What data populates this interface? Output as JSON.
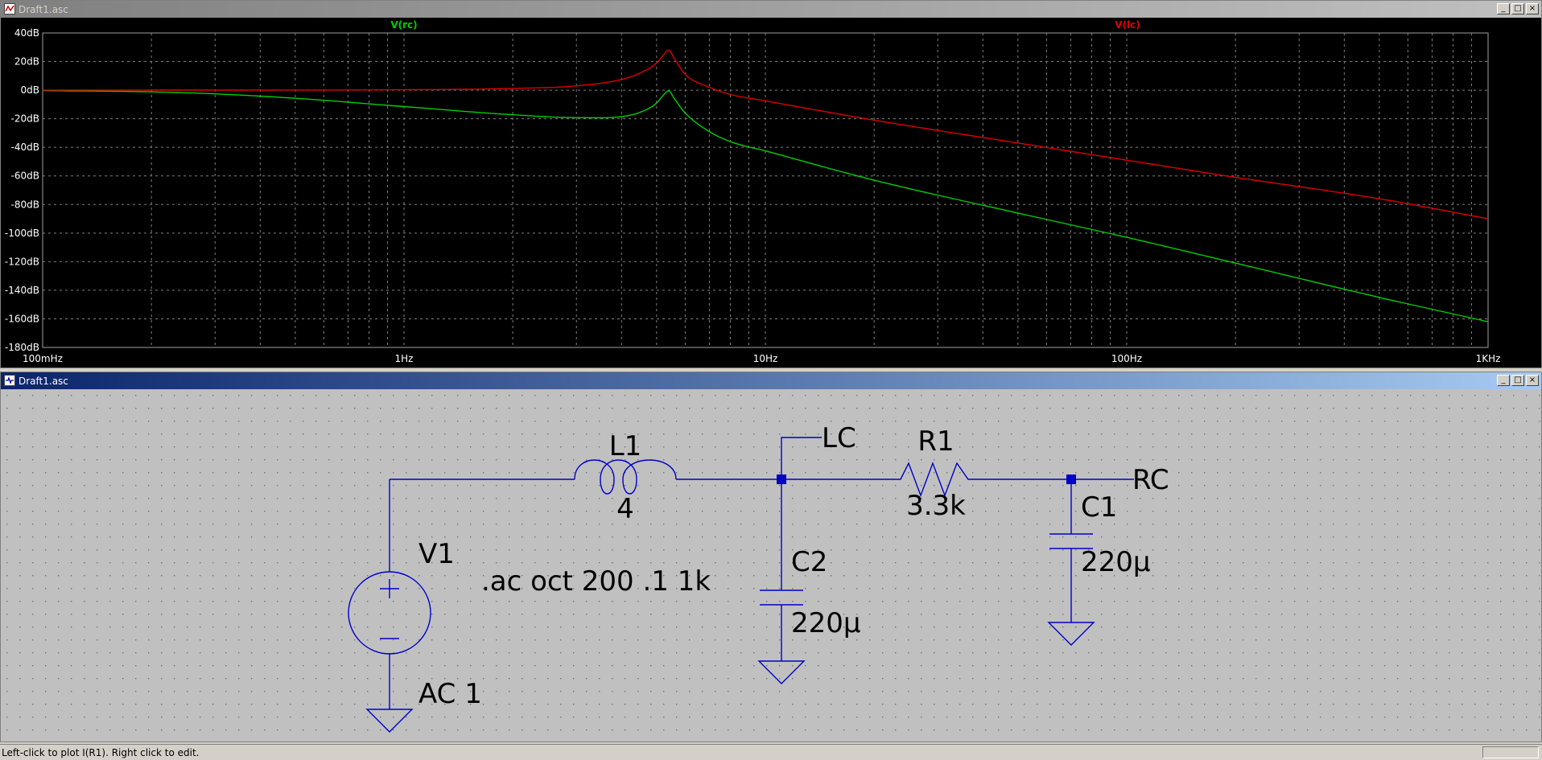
{
  "plot_window": {
    "title": "Draft1.asc",
    "trace_labels": [
      "V(rc)",
      "V(lc)"
    ],
    "colors": {
      "background": "#000000",
      "grid": "#7f7f7f",
      "rc": "#00d000",
      "lc": "#dd0000"
    }
  },
  "chart_data": {
    "type": "line",
    "x_scale": "log",
    "xlim": [
      0.1,
      1000
    ],
    "ylim": [
      -180,
      40
    ],
    "x_ticks": [
      "100mHz",
      "1Hz",
      "10Hz",
      "100Hz",
      "1KHz"
    ],
    "y_ticks": [
      "40dB",
      "20dB",
      "0dB",
      "-20dB",
      "-40dB",
      "-60dB",
      "-80dB",
      "-100dB",
      "-120dB",
      "-140dB",
      "-160dB",
      "-180dB"
    ],
    "series": [
      {
        "name": "V(rc)",
        "color": "#00d000",
        "x": [
          0.1,
          0.2,
          0.3,
          0.5,
          1,
          2,
          3,
          4,
          4.5,
          5,
          5.2,
          5.4,
          5.6,
          6,
          7,
          8,
          10,
          20,
          50,
          100,
          200,
          500,
          1000
        ],
        "y": [
          -0.3,
          -1.2,
          -2.6,
          -5.7,
          -11.5,
          -17.2,
          -19.2,
          -18.5,
          -15.5,
          -9,
          -4,
          -0.5,
          -6,
          -16,
          -29,
          -36,
          -42.5,
          -63,
          -86,
          -103,
          -121,
          -145,
          -162
        ]
      },
      {
        "name": "V(lc)",
        "color": "#dd0000",
        "x": [
          0.1,
          0.5,
          1,
          2,
          3,
          4,
          4.5,
          5,
          5.2,
          5.4,
          5.6,
          6,
          7,
          8,
          10,
          20,
          50,
          100,
          200,
          500,
          1000
        ],
        "y": [
          0,
          0.1,
          0.3,
          1.2,
          3,
          7.5,
          12,
          19,
          24,
          28,
          22,
          11,
          2,
          -3,
          -7.5,
          -21,
          -37,
          -49,
          -61,
          -76,
          -90
        ]
      }
    ]
  },
  "schematic_window": {
    "title": "Draft1.asc",
    "components": {
      "l1_name": "L1",
      "l1_value": "4",
      "r1_name": "R1",
      "r1_value": "3.3k",
      "c1_name": "C1",
      "c1_value": "220µ",
      "c2_name": "C2",
      "c2_value": "220µ",
      "v1_name": "V1",
      "v1_value": "AC 1"
    },
    "net_labels": {
      "lc": "LC",
      "rc": "RC"
    },
    "directive": ".ac oct 200 .1 1k",
    "colors": {
      "wire": "#0000c8",
      "background": "#c0c0c0",
      "text": "#000000"
    }
  },
  "window_controls": {
    "minimize": "_",
    "restore": "□",
    "close": "×"
  },
  "status_bar": {
    "message": "Left-click to plot I(R1).  Right click to edit."
  }
}
